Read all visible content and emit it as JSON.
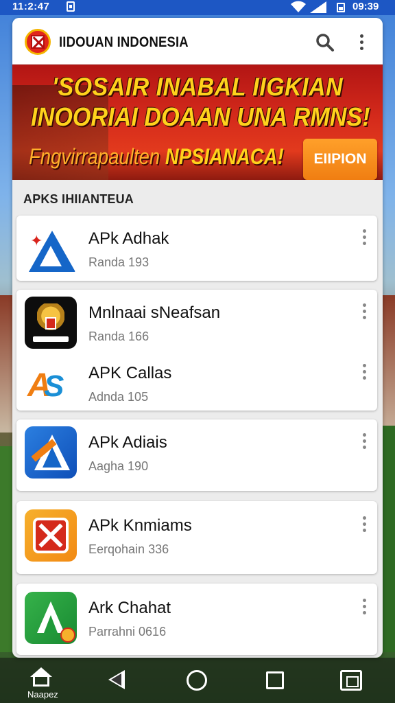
{
  "status_bar": {
    "time": "11:2:47",
    "right_text": "09:39",
    "icons": [
      "sim-icon",
      "wifi-icon",
      "signal-icon",
      "battery-icon"
    ]
  },
  "header": {
    "title": "IIDOUAN INDONESIA",
    "logo_icon": "shield-logo-icon",
    "search_icon": "search-icon",
    "menu_icon": "more-vertical-icon"
  },
  "banner": {
    "line1": "'SOSAIR INABAL IIGKIAN",
    "line2": "INOORIAI DOAAN UNA RMNS!",
    "sub_lead": "Fngvirrapaulten",
    "sub_main": " NPSIANACA!",
    "cta_label": "EIIPION"
  },
  "section": {
    "title": "APKS IHIIANTEUA"
  },
  "apps": [
    {
      "name": "APk Adhak",
      "meta": "Randa 193",
      "icon": "blue-a-app-icon"
    },
    {
      "name": "Mnlnaai sNeafsan",
      "meta": "Randa 166",
      "icon": "garuda-emblem-app-icon"
    },
    {
      "name": "APK Callas",
      "meta": "Adnda 105",
      "icon": "as-letters-app-icon"
    },
    {
      "name": "APk Adiais",
      "meta": "Aagha 190",
      "icon": "blue-a-orange-app-icon"
    },
    {
      "name": "APk Knmiams",
      "meta": "Eerqohain 336",
      "icon": "red-x-app-icon"
    },
    {
      "name": "Ark Chahat",
      "meta": "Parrahni 0616",
      "icon": "green-a-app-icon"
    }
  ],
  "nav_bar": {
    "home_label": "Naapez",
    "icons": [
      "home-icon",
      "back-icon",
      "home-circle-icon",
      "overview-square-icon",
      "recents-icon"
    ]
  },
  "colors": {
    "status_bar": "#1d57c4",
    "banner_red": "#d42a1b",
    "banner_text": "#ffd21c",
    "cta_orange": "#f07e12",
    "card_bg": "#ffffff",
    "list_bg": "#ececec"
  }
}
